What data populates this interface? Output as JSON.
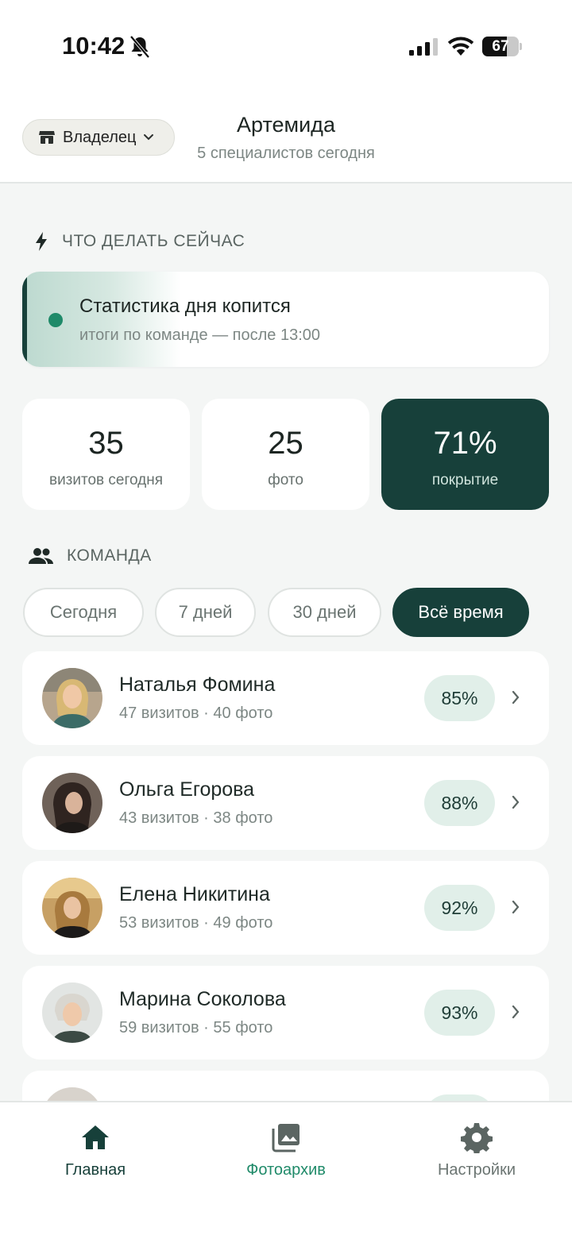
{
  "status_bar": {
    "time": "10:42",
    "battery": "67",
    "battery_level": 0.67
  },
  "header": {
    "role_label": "Владелец",
    "title": "Артемида",
    "subtitle": "5 специалистов сегодня"
  },
  "now_section": {
    "title": "ЧТО ДЕЛАТЬ СЕЙЧАС",
    "card_title": "Статистика дня копится",
    "card_subtitle": "итоги по команде — после 13:00"
  },
  "stats": [
    {
      "value": "35",
      "label": "визитов сегодня"
    },
    {
      "value": "25",
      "label": "фото"
    },
    {
      "value": "71%",
      "label": "покрытие"
    }
  ],
  "team_section": {
    "title": "КОМАНДА",
    "filters": [
      "Сегодня",
      "7 дней",
      "30 дней",
      "Всё время"
    ],
    "active_filter": "Всё время"
  },
  "team": [
    {
      "name": "Наталья Фомина",
      "meta": "47 визитов · 40 фото",
      "percent": "85%"
    },
    {
      "name": "Ольга Егорова",
      "meta": "43 визитов · 38 фото",
      "percent": "88%"
    },
    {
      "name": "Елена Никитина",
      "meta": "53 визитов · 49 фото",
      "percent": "92%"
    },
    {
      "name": "Марина Соколова",
      "meta": "59 визитов · 55 фото",
      "percent": "93%"
    }
  ],
  "tabs": {
    "home": "Главная",
    "photos": "Фотоархив",
    "settings": "Настройки"
  },
  "colors": {
    "primary": "#17403a",
    "accent": "#1f8a69",
    "badge": "#e1efe9",
    "background": "#f4f6f5"
  }
}
